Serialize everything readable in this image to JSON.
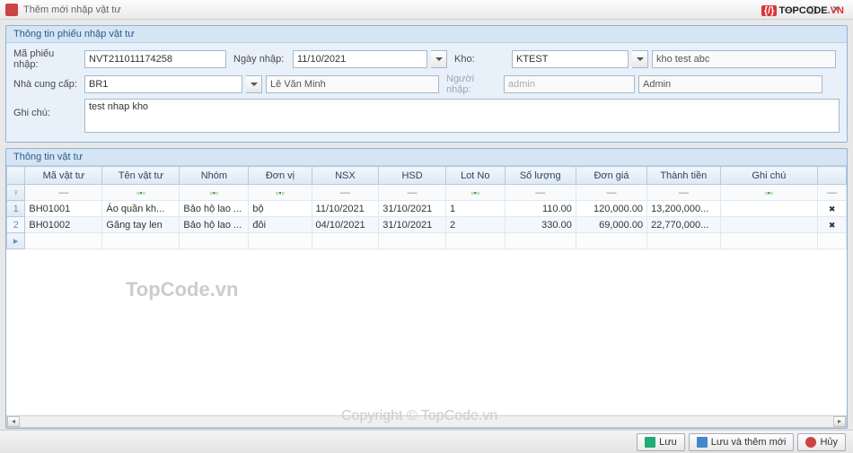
{
  "window": {
    "title": "Thêm mới nhập vật tư"
  },
  "panels": {
    "p1_title": "Thông tin phiếu nhập vật tư",
    "p2_title": "Thông tin vật tư"
  },
  "form": {
    "ma_phieu_label": "Mã phiếu nhập:",
    "ma_phieu": "NVT211011174258",
    "ngay_nhap_label": "Ngày nhập:",
    "ngay_nhap": "11/10/2021",
    "kho_label": "Kho:",
    "kho_code": "KTEST",
    "kho_name": "kho test abc",
    "ncc_label": "Nhà cung cấp:",
    "ncc_code": "BR1",
    "ncc_name": "Lê Văn Minh",
    "nguoi_nhap_label": "Người nhập:",
    "nguoi_nhap_code": "admin",
    "nguoi_nhap_name": "Admin",
    "ghichu_label": "Ghi chú:",
    "ghichu": "test nhap kho"
  },
  "grid": {
    "columns": [
      "Mã vật tư",
      "Tên vật tư",
      "Nhóm",
      "Đơn vị",
      "NSX",
      "HSD",
      "Lot No",
      "Số lượng",
      "Đơn giá",
      "Thành tiền",
      "Ghi chú",
      ""
    ],
    "rows": [
      {
        "idx": "1",
        "ma": "BH01001",
        "ten": "Áo quần kh...",
        "nhom": "Bảo hộ lao ...",
        "dv": "bộ",
        "nsx": "11/10/2021",
        "hsd": "31/10/2021",
        "lot": "1",
        "sl": "110.00",
        "dg": "120,000.00",
        "tt": "13,200,000...",
        "gc": ""
      },
      {
        "idx": "2",
        "ma": "BH01002",
        "ten": "Găng tay len",
        "nhom": "Bảo hộ lao ...",
        "dv": "đôi",
        "nsx": "04/10/2021",
        "hsd": "31/10/2021",
        "lot": "2",
        "sl": "330.00",
        "dg": "69,000.00",
        "tt": "22,770,000...",
        "gc": ""
      }
    ]
  },
  "footer": {
    "save": "Lưu",
    "save_new": "Lưu và thêm mới",
    "cancel": "Hủy"
  },
  "watermarks": {
    "w1": "TopCode.vn",
    "w2": "Copyright © TopCode.vn",
    "logo_text": "TOPCODE",
    "logo_vn": ".VN"
  }
}
